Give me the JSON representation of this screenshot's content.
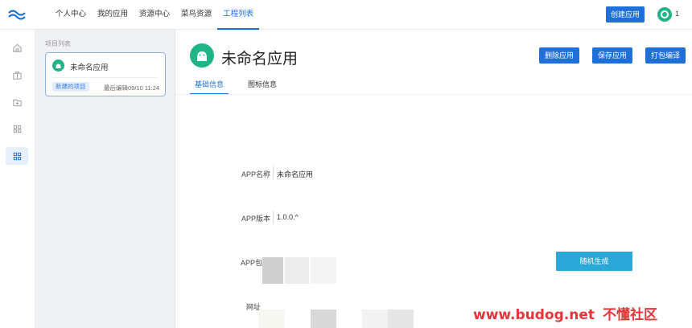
{
  "topbar": {
    "nav": [
      "个人中心",
      "我的应用",
      "资源中心",
      "菜鸟资源",
      "工程列表"
    ],
    "active_index": 4,
    "create_label": "创建应用",
    "user_count": "1"
  },
  "colors": {
    "primary": "#1e6fd9",
    "android_green": "#20b486",
    "random_btn": "#2aa8d8",
    "watermark": "#e8353a"
  },
  "rail": {
    "icons": [
      "home-icon",
      "briefcase-icon",
      "folder-add-icon",
      "grid-icon",
      "apps-icon"
    ],
    "active_index": 4
  },
  "projects": {
    "title": "项目列表",
    "card": {
      "name": "未命名应用",
      "badge": "新建的项目",
      "edited": "最后编辑09/10 11:24"
    }
  },
  "main": {
    "title": "未命名应用",
    "actions": {
      "delete": "删除应用",
      "save": "保存应用",
      "build": "打包编译"
    },
    "tabs": [
      "基础信息",
      "图标信息"
    ],
    "fields": {
      "app_name_label": "APP名称",
      "app_name_value": "未命名应用",
      "app_version_label": "APP版本",
      "app_version_value": "1.0.0.^",
      "app_package_label": "APP包",
      "url_label": "网址"
    },
    "random_label": "随机生成"
  },
  "watermark": {
    "url": "www.budog.net",
    "text": "不懂社区"
  }
}
